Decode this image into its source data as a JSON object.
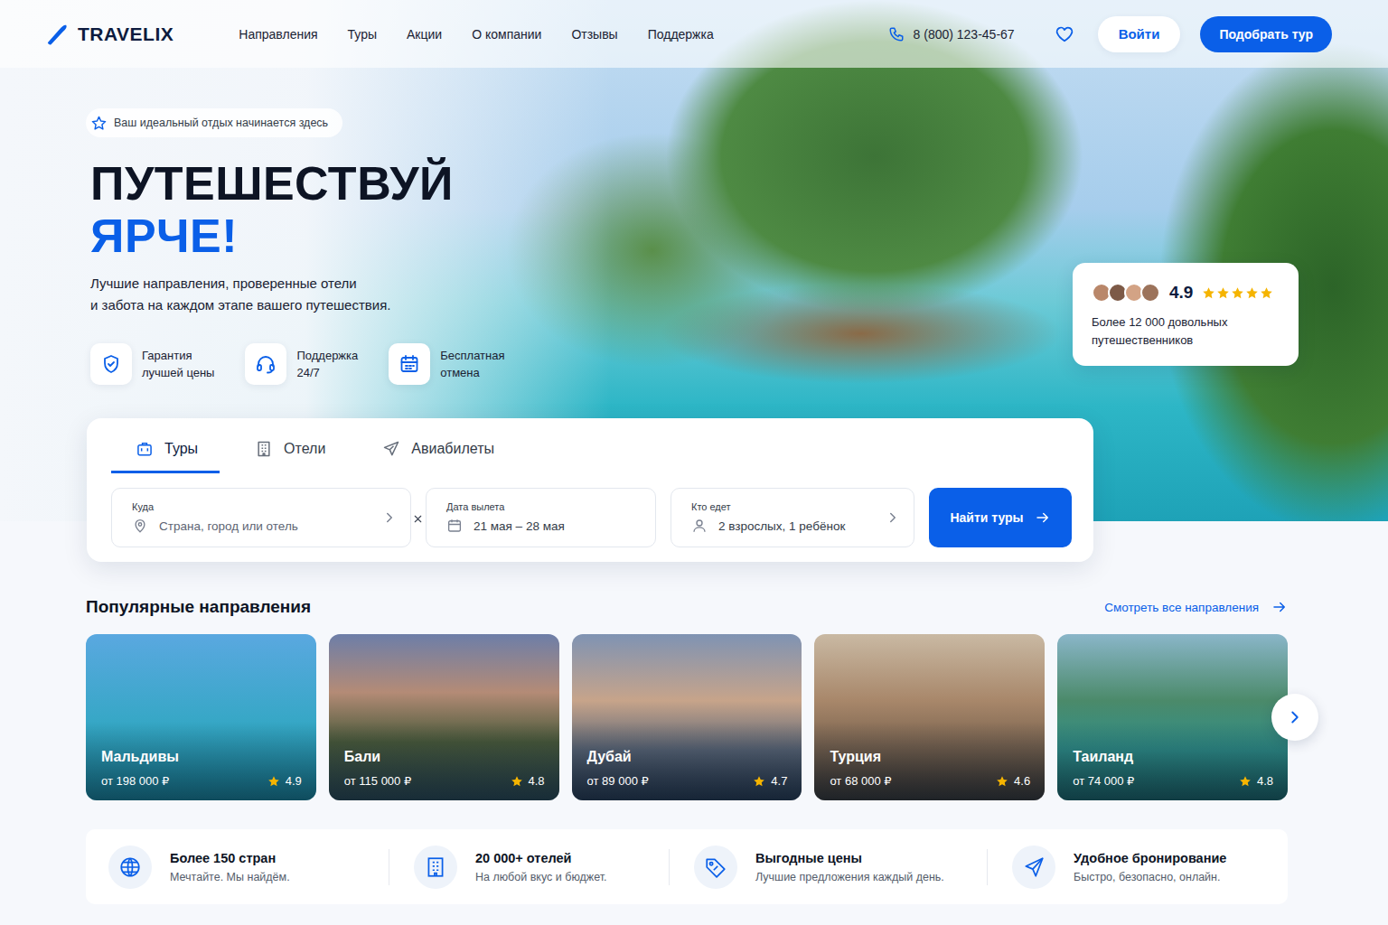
{
  "header": {
    "logo": "TRAVELIX",
    "nav": [
      "Направления",
      "Туры",
      "Акции",
      "О компании",
      "Отзывы",
      "Поддержка"
    ],
    "phone": "8 (800) 123-45-67",
    "login": "Войти",
    "cta": "Подобрать тур"
  },
  "hero": {
    "badge": "Ваш идеальный отдых начинается здесь",
    "title_line1": "ПУТЕШЕСТВУЙ",
    "title_line2": "ЯРЧЕ!",
    "subtitle_lines": [
      "Лучшие направления, проверенные отели",
      "и забота на каждом этапе вашего путешествия."
    ],
    "features": [
      {
        "kind": "price-guarantee",
        "lines": [
          "Гарантия",
          "лучшей цены"
        ]
      },
      {
        "kind": "support",
        "lines": [
          "Поддержка",
          "24/7"
        ]
      },
      {
        "kind": "free-cancel",
        "lines": [
          "Бесплатная",
          "отмена"
        ]
      }
    ]
  },
  "rating": {
    "score": "4.9",
    "stars": 5,
    "lines": [
      "Более 12 000 довольных",
      "путешественников"
    ]
  },
  "search": {
    "tabs": [
      {
        "kind": "tours",
        "label": "Туры",
        "selected": true
      },
      {
        "kind": "hotels",
        "label": "Отели",
        "selected": false
      },
      {
        "kind": "flights",
        "label": "Авиабилеты",
        "selected": false
      }
    ],
    "fields": [
      {
        "kind": "destination",
        "label": "Куда",
        "value": "Страна, город или отель",
        "empty": true
      },
      {
        "kind": "date",
        "label": "Дата вылета",
        "value": "21 мая – 28 мая",
        "empty": false
      },
      {
        "kind": "travelers",
        "label": "Кто едет",
        "value": "2 взрослых, 1 ребёнок",
        "empty": false
      }
    ],
    "button": "Найти туры"
  },
  "popular": {
    "title": "Популярные направления",
    "link": "Смотреть все направления",
    "cards": [
      {
        "name": "Мальдивы",
        "price": "от 198 000 ₽",
        "rating": "4.9"
      },
      {
        "name": "Бали",
        "price": "от 115 000 ₽",
        "rating": "4.8"
      },
      {
        "name": "Дубай",
        "price": "от 89 000 ₽",
        "rating": "4.7"
      },
      {
        "name": "Турция",
        "price": "от 68 000 ₽",
        "rating": "4.6"
      },
      {
        "name": "Таиланд",
        "price": "от 74 000 ₽",
        "rating": "4.8"
      }
    ]
  },
  "stats": [
    {
      "kind": "countries",
      "title": "Более 150 стран",
      "subtitle": "Мечтайте. Мы найдём."
    },
    {
      "kind": "hotels",
      "title": "20 000+ отелей",
      "subtitle": "На любой вкус и бюджет."
    },
    {
      "kind": "prices",
      "title": "Выгодные цены",
      "subtitle": "Лучшие предложения каждый день."
    },
    {
      "kind": "booking",
      "title": "Удобное бронирование",
      "subtitle": "Быстро, безопасно, онлайн."
    }
  ]
}
